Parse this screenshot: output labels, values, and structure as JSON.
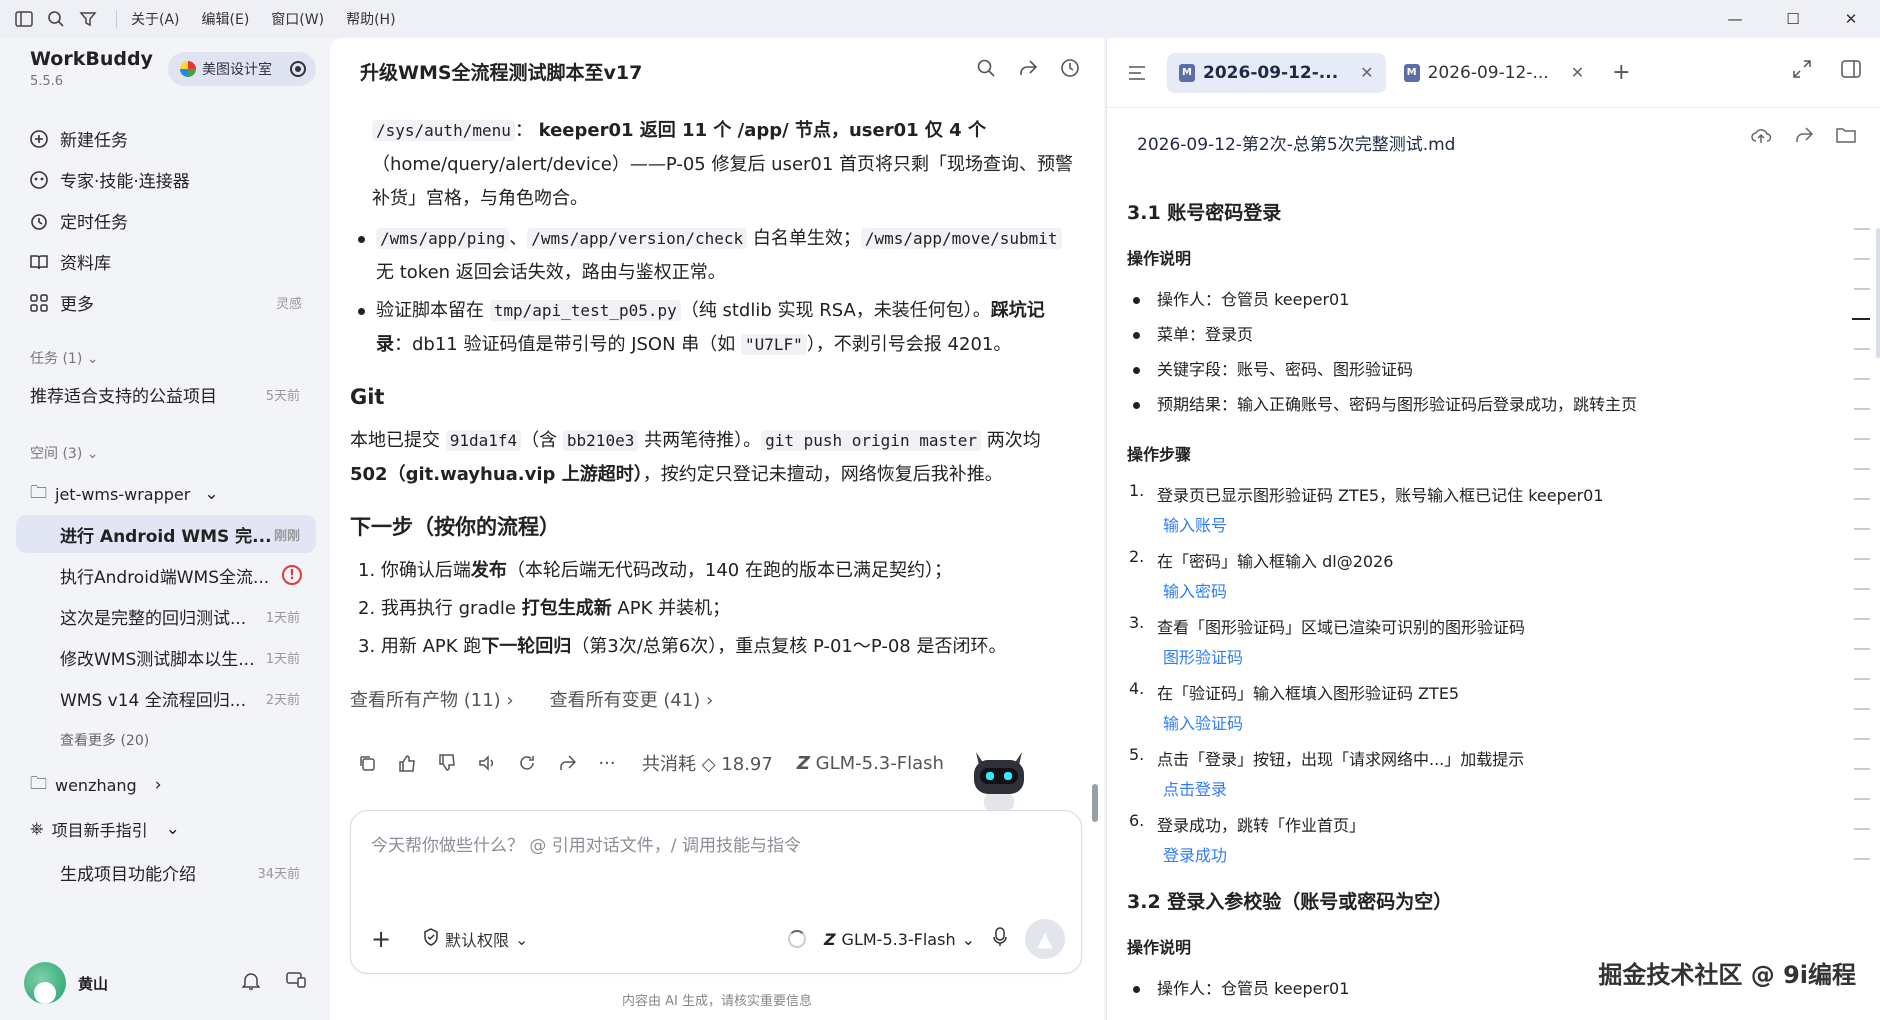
{
  "titlebar": {
    "menus": [
      "关于(A)",
      "编辑(E)",
      "窗口(W)",
      "帮助(H)"
    ]
  },
  "brand": {
    "name": "WorkBuddy",
    "version": "5.5.6",
    "workspace": "美图设计室"
  },
  "nav": [
    {
      "label": "新建任务",
      "icon": "plus-circle-icon"
    },
    {
      "label": "专家·技能·连接器",
      "icon": "expert-icon"
    },
    {
      "label": "定时任务",
      "icon": "alarm-icon"
    },
    {
      "label": "资料库",
      "icon": "book-icon"
    },
    {
      "label": "更多",
      "icon": "grid-icon",
      "badge": "灵感"
    }
  ],
  "tasks": {
    "title": "任务 (1)",
    "items": [
      {
        "label": "推荐适合支持的公益项目",
        "time": "5天前"
      }
    ]
  },
  "spaces": {
    "title": "空间 (3)",
    "folder1": "jet-wms-wrapper",
    "items": [
      {
        "label": "进行 Android WMS 完...",
        "time": "刚刚"
      },
      {
        "label": "执行Android端WMS全流...",
        "time": ""
      },
      {
        "label": "这次是完整的回归测试...",
        "time": "1天前"
      },
      {
        "label": "修改WMS测试脚本以生...",
        "time": "1天前"
      },
      {
        "label": "WMS v14 全流程回归...",
        "time": "2天前"
      }
    ],
    "more": "查看更多 (20)",
    "folder2": "wenzhang",
    "folder3": "项目新手指引",
    "guide_item": {
      "label": "生成项目功能介绍",
      "time": "34天前"
    }
  },
  "user": {
    "name": "黄山"
  },
  "chat": {
    "title": "升级WMS全流程测试脚本至v17",
    "p1_code": "/sys/auth/menu",
    "p1_bold": "keeper01 返回 11 个 /app/ 节点，user01 仅 4 个",
    "p1_rest": "（home/query/alert/device）——P-05 修复后 user01 首页将只剩「现场查询、预警补货」宫格，与角色吻合。",
    "b1_code1": "/wms/app/ping",
    "b1_sep": "、",
    "b1_code2": "/wms/app/version/check",
    "b1_t1": " 白名单生效；",
    "b1_code3": "/wms/app/move/submit",
    "b1_t2": " 无 token 返回会话失效，路由与鉴权正常。",
    "b2_t1": "验证脚本留在 ",
    "b2_code": "tmp/api_test_p05.py",
    "b2_t2": "（纯 stdlib 实现 RSA，未装任何包）。",
    "b2_bold": "踩坑记录",
    "b2_t3": "：db11 验证码值是带引号的 JSON 串（如 ",
    "b2_code2": "\"U7LF\"",
    "b2_t4": "），不剥引号会报 4201。",
    "git_h": "Git",
    "git_t1": "本地已提交 ",
    "git_c1": "91da1f4",
    "git_t2": "（含 ",
    "git_c2": "bb210e3",
    "git_t3": " 共两笔待推）。",
    "git_c3": "git push origin master",
    "git_t4": " 两次均 ",
    "git_bold": "502（git.wayhua.vip 上游超时）",
    "git_t5": "，按约定只登记未擅动，网络恢复后我补推。",
    "next_h": "下一步（按你的流程）",
    "s1_a": "1. 你确认后端",
    "s1_b": "发布",
    "s1_c": "（本轮后端无代码改动，140 在跑的版本已满足契约）；",
    "s2_a": "2. 我再执行 gradle ",
    "s2_b": "打包生成新",
    "s2_c": " APK 并装机；",
    "s3_a": "3. 用新 APK 跑",
    "s3_b": "下一轮回归",
    "s3_c": "（第3次/总第6次），重点复核 P-01～P-08 是否闭环。",
    "link1": "查看所有产物 (11)",
    "link2": "查看所有变更 (41)",
    "cost": "共消耗 ◇ 18.97",
    "model": "GLM-5.3-Flash",
    "placeholder": "今天帮你做些什么？ @ 引用对话文件，/ 调用技能与指令",
    "perm": "默认权限",
    "model2": "GLM-5.3-Flash",
    "disclaimer": "内容由 AI 生成，请核实重要信息"
  },
  "doc": {
    "tab1": "2026-09-12-...",
    "tab2": "2026-09-12-...",
    "filename": "2026-09-12-第2次-总第5次完整测试.md",
    "h31": "3.1 账号密码登录",
    "op_desc": "操作说明",
    "op_list": [
      "操作人：仓管员 keeper01",
      "菜单：登录页",
      "关键字段：账号、密码、图形验证码",
      "预期结果：输入正确账号、密码与图形验证码后登录成功，跳转主页"
    ],
    "op_steps": "操作步骤",
    "steps": [
      {
        "n": "1.",
        "t": "登录页已显示图形验证码 ZTE5，账号输入框已记住 keeper01",
        "link": "输入账号"
      },
      {
        "n": "2.",
        "t": "在「密码」输入框输入 dl@2026",
        "link": "输入密码"
      },
      {
        "n": "3.",
        "t": "查看「图形验证码」区域已渲染可识别的图形验证码",
        "link": "图形验证码"
      },
      {
        "n": "4.",
        "t": "在「验证码」输入框填入图形验证码 ZTE5",
        "link": "输入验证码"
      },
      {
        "n": "5.",
        "t": "点击「登录」按钮，出现「请求网络中...」加载提示",
        "link": "点击登录"
      },
      {
        "n": "6.",
        "t": "登录成功，跳转「作业首页」",
        "link": "登录成功"
      }
    ],
    "h32": "3.2 登录入参校验（账号或密码为空）",
    "op_desc2": "操作说明",
    "op2_first": "操作人：仓管员 keeper01"
  },
  "watermark": "掘金技术社区 @ 9i编程"
}
